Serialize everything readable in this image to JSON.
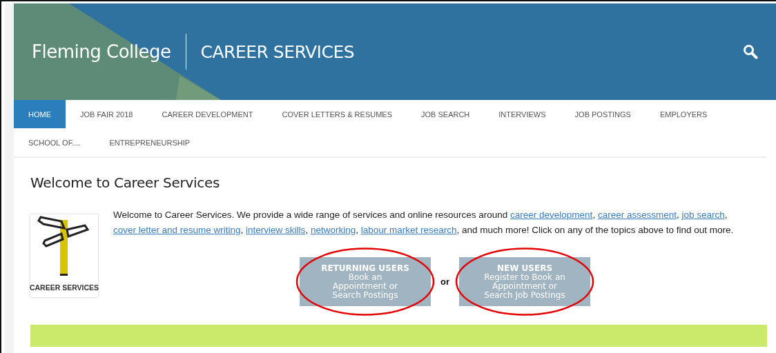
{
  "header": {
    "college": "Fleming College",
    "section": "CAREER SERVICES"
  },
  "nav": [
    {
      "label": "HOME",
      "selected": true
    },
    {
      "label": "JOB FAIR 2018",
      "selected": false
    },
    {
      "label": "CAREER DEVELOPMENT",
      "selected": false
    },
    {
      "label": "COVER LETTERS & RESUMES",
      "selected": false
    },
    {
      "label": "JOB SEARCH",
      "selected": false
    },
    {
      "label": "INTERVIEWS",
      "selected": false
    },
    {
      "label": "JOB POSTINGS",
      "selected": false
    },
    {
      "label": "EMPLOYERS",
      "selected": false
    },
    {
      "label": "SCHOOL OF....",
      "selected": false
    },
    {
      "label": "ENTREPRENEURSHIP",
      "selected": false
    }
  ],
  "heading": "Welcome to Career Services",
  "logo": {
    "caption": "CAREER SERVICES"
  },
  "intro": [
    {
      "kind": "text",
      "text": "Welcome to Career Services. We provide a wide range of services and online resources around "
    },
    {
      "kind": "link",
      "text": "career development"
    },
    {
      "kind": "text",
      "text": ", "
    },
    {
      "kind": "link",
      "text": "career assessment"
    },
    {
      "kind": "text",
      "text": ", "
    },
    {
      "kind": "link",
      "text": "job search"
    },
    {
      "kind": "text",
      "text": ", "
    },
    {
      "kind": "link",
      "text": "cover letter and resume writing"
    },
    {
      "kind": "text",
      "text": ", "
    },
    {
      "kind": "link",
      "text": "interview skills"
    },
    {
      "kind": "text",
      "text": ", "
    },
    {
      "kind": "link",
      "text": "networking"
    },
    {
      "kind": "text",
      "text": ", "
    },
    {
      "kind": "link",
      "text": "labour market research"
    },
    {
      "kind": "text",
      "text": ", and much more!  Click on any of the topics above to find out more."
    }
  ],
  "actions": [
    {
      "title": "RETURNING USERS",
      "lines": [
        "Book an",
        "Appointment or",
        "Search Postings"
      ],
      "circled": true
    },
    {
      "title": "NEW USERS",
      "lines": [
        "Register to Book an",
        "Appointment or",
        "Search Job Postings"
      ],
      "circled": true
    }
  ],
  "separator": "or"
}
